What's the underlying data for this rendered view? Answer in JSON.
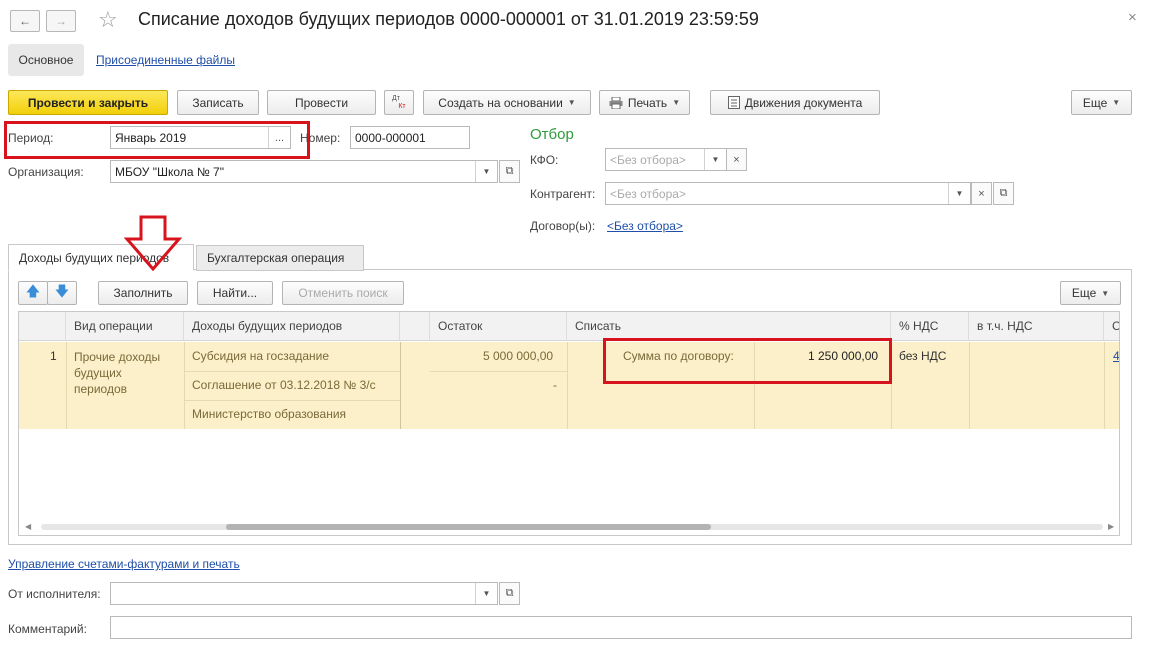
{
  "window": {
    "title": "Списание доходов будущих периодов 0000-000001 от 31.01.2019 23:59:59",
    "close_glyph": "×"
  },
  "nav": {
    "back_glyph": "←",
    "forward_glyph": "→",
    "star_glyph": "☆"
  },
  "sections": {
    "main": "Основное",
    "attached": "Присоединенные файлы"
  },
  "toolbar": {
    "post_close": "Провести и закрыть",
    "save": "Записать",
    "post": "Провести",
    "dtkt_top": "Дт",
    "dtkt_bottom": "Кт",
    "create_based": "Создать на основании",
    "print": "Печать",
    "movements": "Движения документа",
    "more": "Еще"
  },
  "form": {
    "period_label": "Период:",
    "period_value": "Январь 2019",
    "number_label": "Номер:",
    "number_value": "0000-000001",
    "org_label": "Организация:",
    "org_value": "МБОУ \"Школа № 7\"",
    "ellipsis": "...",
    "filter_title": "Отбор",
    "kfo_label": "КФО:",
    "kfo_placeholder": "<Без отбора>",
    "contractor_label": "Контрагент:",
    "contractor_placeholder": "<Без отбора>",
    "contracts_label": "Договор(ы):",
    "contracts_link": "<Без отбора>"
  },
  "tabs": [
    {
      "label": "Доходы будущих периодов"
    },
    {
      "label": "Бухгалтерская операция"
    }
  ],
  "table_toolbar": {
    "fill": "Заполнить",
    "find": "Найти...",
    "cancel_search": "Отменить поиск",
    "more": "Еще"
  },
  "table": {
    "columns": [
      "Вид операции",
      "Доходы будущих периодов",
      "Остаток",
      "Списать",
      "% НДС",
      "в т.ч. НДС",
      "С"
    ],
    "row": {
      "n": "1",
      "operation": [
        "Прочие доходы",
        "будущих",
        "периодов"
      ],
      "income": [
        "Субсидия на госзадание",
        "Соглашение от 03.12.2018 № 3/с",
        "Министерство образования"
      ],
      "balance": "5 000 000,00",
      "balance_dash": "-",
      "writeoff_label": "Сумма по договору:",
      "writeoff_value": "1 250 000,00",
      "vat": "без НДС",
      "cut": "4"
    }
  },
  "footer": {
    "invoice_link": "Управление счетами-фактурами и печать",
    "executor_label": "От исполнителя:",
    "executor_value": "",
    "comment_label": "Комментарий:",
    "comment_value": ""
  },
  "colors": {
    "accent_yellow": "#f2cf0a",
    "highlight_red": "#d7141d",
    "row_yellow": "#fbf0c9",
    "link_blue": "#1f4fa8",
    "filter_green": "#2e9a3a"
  }
}
